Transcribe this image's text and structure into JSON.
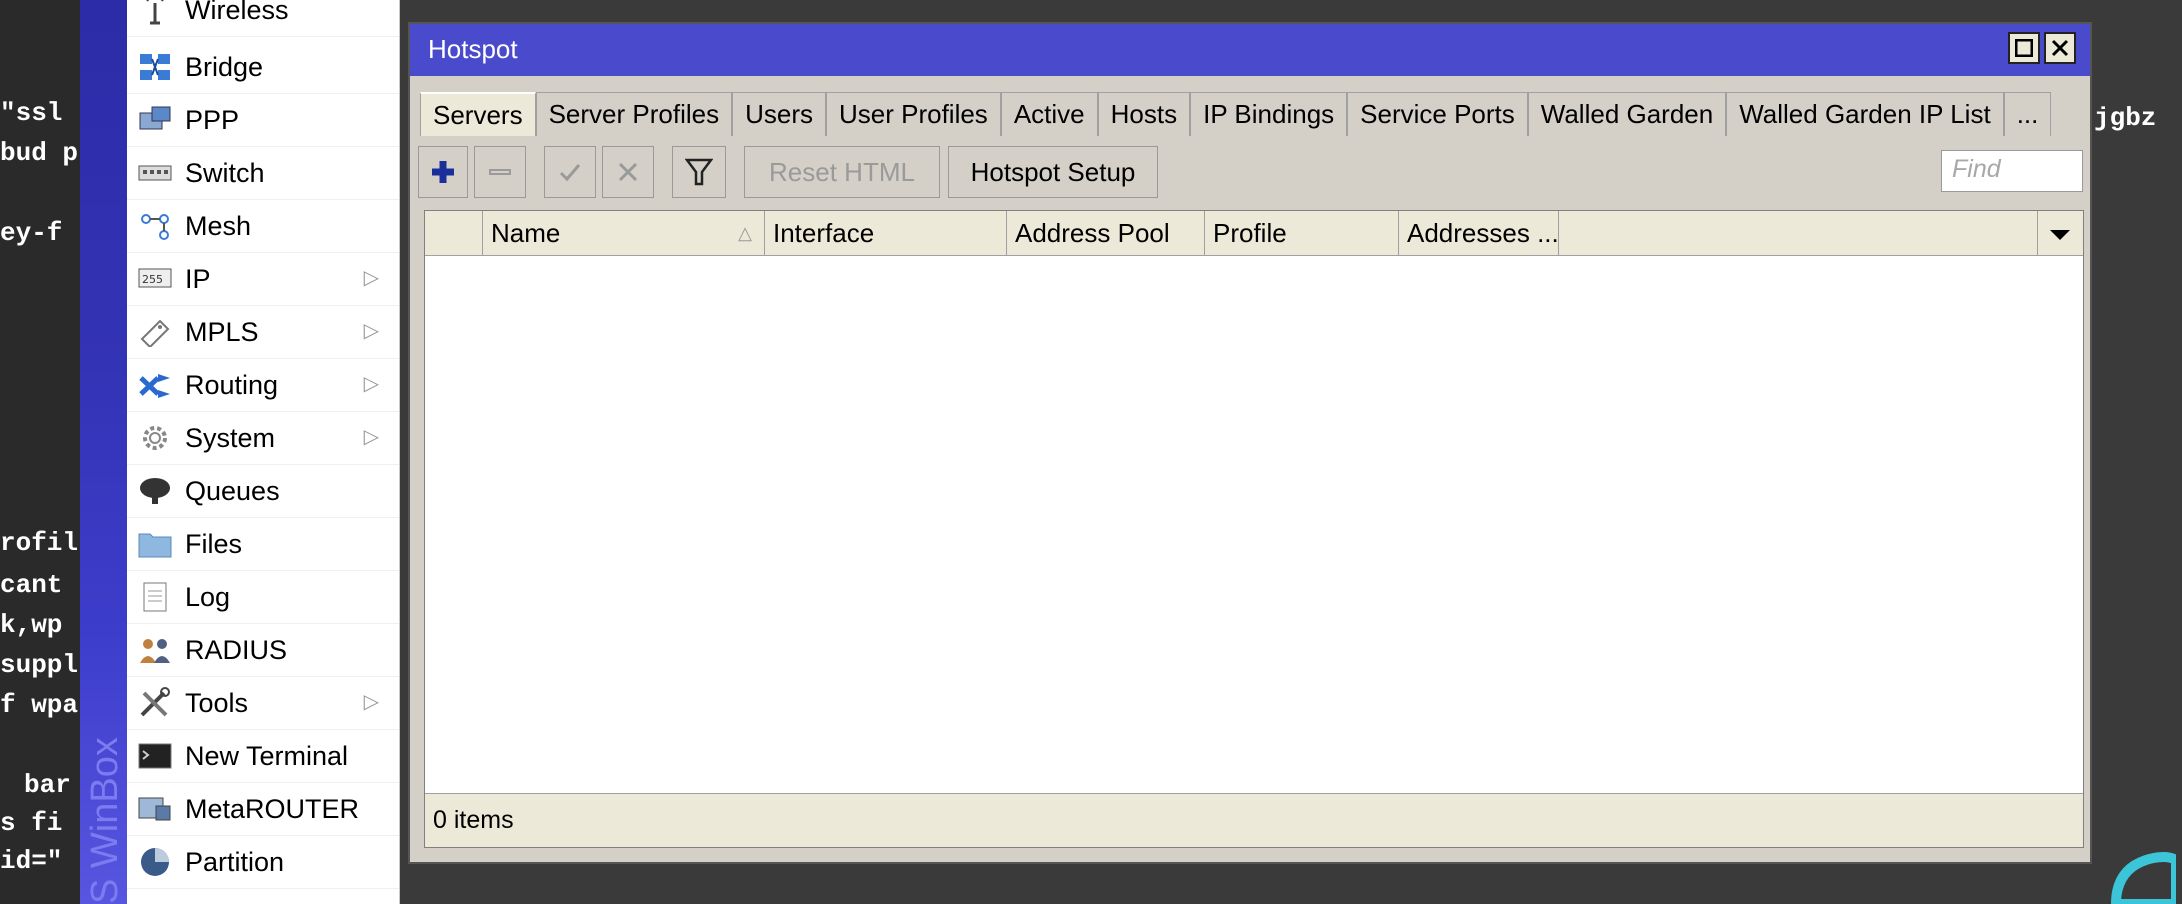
{
  "terminal_left": [
    "\"ssl",
    "bud p",
    "ey-f",
    "rofil",
    "cant",
    "k,wp",
    "suppl",
    "f wpa",
    "bar",
    "s fi",
    "id=\""
  ],
  "terminal_right": "jgbz",
  "brand": "S WinBox",
  "menu": [
    {
      "label": "Wireless",
      "icon": "wireless-icon",
      "submenu": false
    },
    {
      "label": "Bridge",
      "icon": "bridge-icon",
      "submenu": false
    },
    {
      "label": "PPP",
      "icon": "ppp-icon",
      "submenu": false
    },
    {
      "label": "Switch",
      "icon": "switch-icon",
      "submenu": false
    },
    {
      "label": "Mesh",
      "icon": "mesh-icon",
      "submenu": false
    },
    {
      "label": "IP",
      "icon": "ip-icon",
      "submenu": true
    },
    {
      "label": "MPLS",
      "icon": "mpls-icon",
      "submenu": true
    },
    {
      "label": "Routing",
      "icon": "routing-icon",
      "submenu": true
    },
    {
      "label": "System",
      "icon": "system-icon",
      "submenu": true
    },
    {
      "label": "Queues",
      "icon": "queues-icon",
      "submenu": false
    },
    {
      "label": "Files",
      "icon": "files-icon",
      "submenu": false
    },
    {
      "label": "Log",
      "icon": "log-icon",
      "submenu": false
    },
    {
      "label": "RADIUS",
      "icon": "radius-icon",
      "submenu": false
    },
    {
      "label": "Tools",
      "icon": "tools-icon",
      "submenu": true
    },
    {
      "label": "New Terminal",
      "icon": "terminal-icon",
      "submenu": false
    },
    {
      "label": "MetaROUTER",
      "icon": "metarouter-icon",
      "submenu": false
    },
    {
      "label": "Partition",
      "icon": "partition-icon",
      "submenu": false
    }
  ],
  "window": {
    "title": "Hotspot",
    "tabs": [
      "Servers",
      "Server Profiles",
      "Users",
      "User Profiles",
      "Active",
      "Hosts",
      "IP Bindings",
      "Service Ports",
      "Walled Garden",
      "Walled Garden IP List",
      "..."
    ],
    "active_tab": "Servers",
    "toolbar": {
      "reset_html": "Reset HTML",
      "hotspot_setup": "Hotspot Setup",
      "find_placeholder": "Find"
    },
    "columns": [
      "Name",
      "Interface",
      "Address Pool",
      "Profile",
      "Addresses ..."
    ],
    "status": "0 items"
  },
  "colors": {
    "titlebar": "#4a4acc",
    "window_bg": "#d4d0c8",
    "add_blue": "#1a2f9a"
  }
}
